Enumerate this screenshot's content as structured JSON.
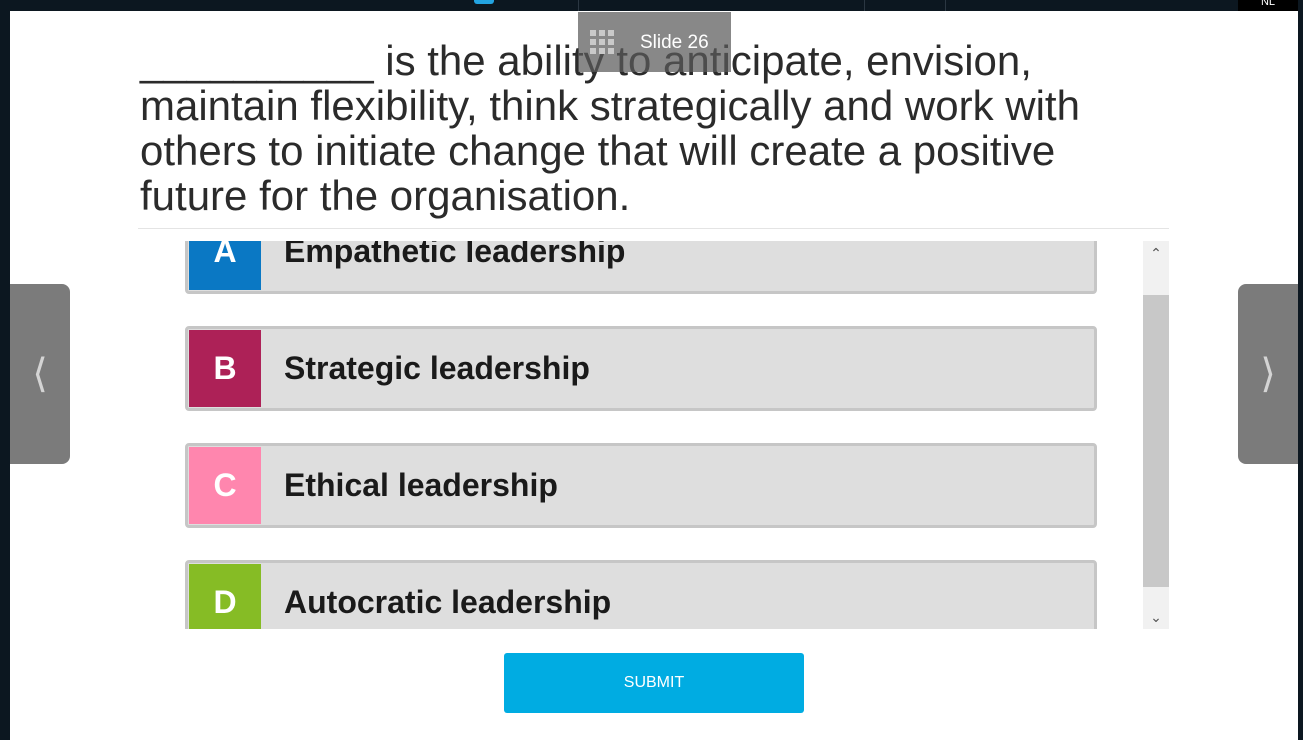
{
  "header": {
    "language_code": "NL"
  },
  "slide": {
    "label": "Slide 26"
  },
  "question": {
    "text": "__________ is the ability to anticipate, envision, maintain flexibility, think strategically and work with others to initiate change that will create a positive future for the organisation."
  },
  "options": [
    {
      "letter": "A",
      "text": "Empathetic leadership",
      "color": "#0a78c4"
    },
    {
      "letter": "B",
      "text": "Strategic leadership",
      "color": "#ad2157"
    },
    {
      "letter": "C",
      "text": "Ethical leadership",
      "color": "#ff86ae"
    },
    {
      "letter": "D",
      "text": "Autocratic leadership",
      "color": "#86bc25"
    }
  ],
  "navigation": {
    "prev_icon": "chevron-left-icon",
    "next_icon": "chevron-right-icon"
  },
  "scroll": {
    "up_icon": "chevron-up-icon",
    "down_icon": "chevron-down-icon"
  },
  "submit": {
    "label": "SUBMIT",
    "color": "#00ace2"
  }
}
